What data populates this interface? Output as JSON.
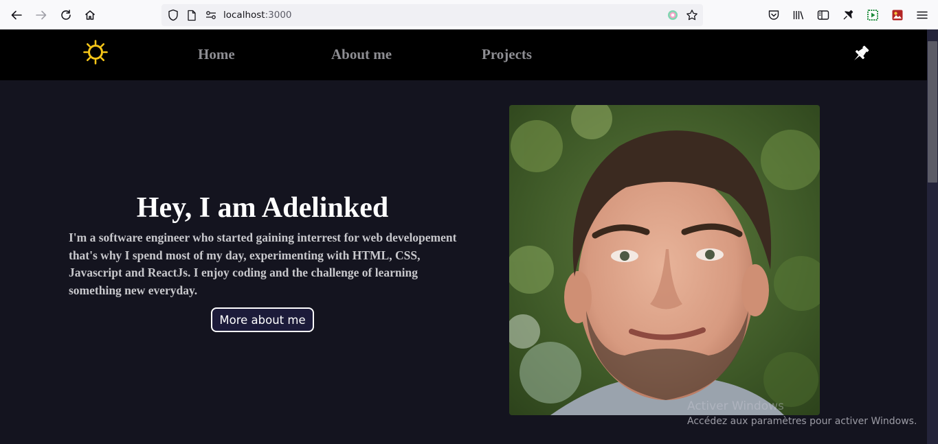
{
  "browser": {
    "url_host": "localhost",
    "url_port": ":3000",
    "toolbar_icons": [
      "back-icon",
      "forward-icon",
      "reload-icon",
      "home-icon",
      "shield-icon",
      "page-icon",
      "permissions-icon",
      "extension-icon",
      "bookmark-star-icon",
      "pocket-icon",
      "library-icon",
      "sidebar-icon",
      "extensions-icon",
      "media-extension-icon",
      "addon-icon",
      "menu-icon"
    ]
  },
  "nav": {
    "logo_icon": "sun-icon",
    "links": [
      "Home",
      "About me",
      "Projects"
    ],
    "pin_icon": "pin-icon"
  },
  "hero": {
    "heading": "Hey, I am Adelinked",
    "text": "I'm a software engineer who started gaining interrest for web developement that's why I spend most of my day, experimenting with HTML, CSS, Javascript and ReactJs. I enjoy coding and the challenge of learning something new everyday.",
    "button_label": "More about me",
    "photo": "profile-photo"
  },
  "watermark": {
    "title": "Activer Windows",
    "subtitle": "Accédez aux paramètres pour activer Windows."
  },
  "colors": {
    "page_bg": "#14141f",
    "nav_bg": "#000000",
    "nav_link": "#8e8e93",
    "sun": "#f5c518",
    "button_bg": "#1c1b3a"
  }
}
